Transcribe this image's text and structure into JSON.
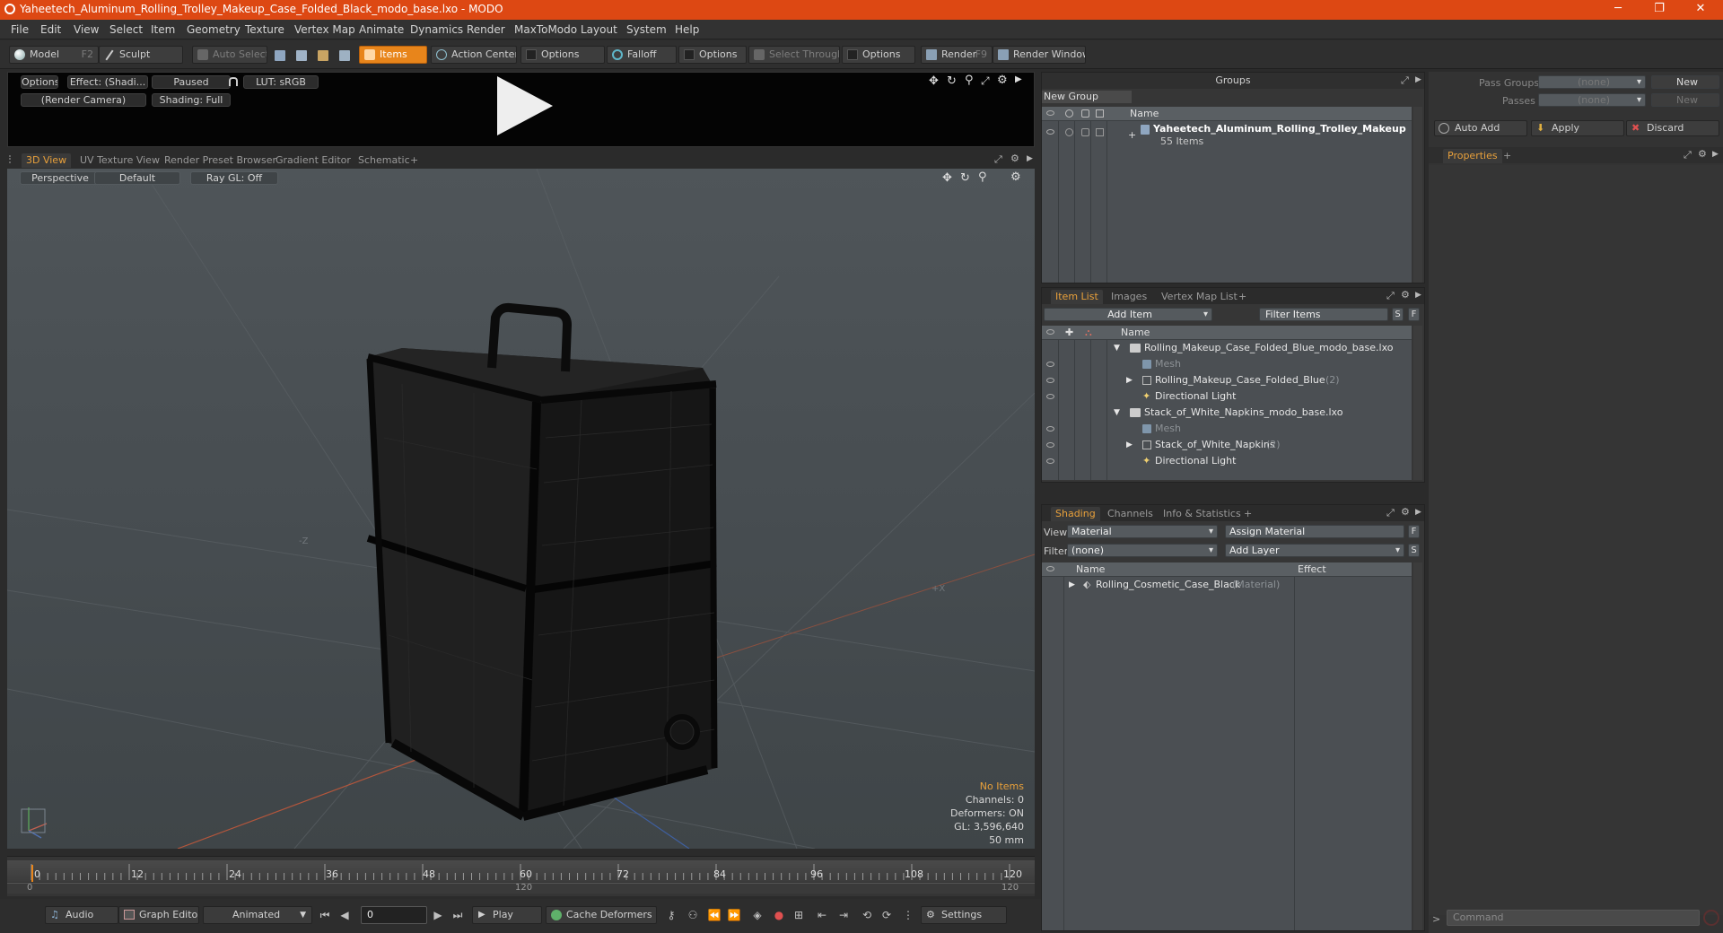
{
  "window": {
    "title": "Yaheetech_Aluminum_Rolling_Trolley_Makeup_Case_Folded_Black_modo_base.lxo - MODO",
    "minimize": "─",
    "restore": "❐",
    "close": "✕"
  },
  "menu": [
    "File",
    "Edit",
    "View",
    "Select",
    "Item",
    "Geometry",
    "Texture",
    "Vertex Map",
    "Animate",
    "Dynamics",
    "Render",
    "MaxToModo",
    "Layout",
    "System",
    "Help"
  ],
  "toolbar": {
    "model": "Model",
    "model_key": "F2",
    "sculpt": "Sculpt",
    "auto_select": "Auto Select",
    "items": "Items",
    "action_center": "Action Center",
    "options1": "Options",
    "falloff": "Falloff",
    "options2": "Options",
    "select_through": "Select Through",
    "options3": "Options",
    "render": "Render",
    "render_key": "F9",
    "render_window": "Render Window"
  },
  "preview": {
    "options": "Options",
    "effect": "Effect: (Shadi...",
    "paused": "Paused",
    "lut": "LUT: sRGB",
    "camera": "(Render Camera)",
    "shading": "Shading: Full"
  },
  "view_tabs": [
    "3D View",
    "UV Texture View",
    "Render Preset Browser",
    "Gradient Editor",
    "Schematic",
    "+"
  ],
  "viewport": {
    "perspective": "Perspective",
    "default": "Default",
    "raygl": "Ray GL: Off",
    "axis_neg_z": "-Z",
    "axis_pos_x": "+X",
    "stats": {
      "no_items": "No Items",
      "channels": "Channels: 0",
      "deformers": "Deformers: ON",
      "gl": "GL: 3,596,640",
      "mm": "50 mm"
    }
  },
  "timeline": {
    "ticks": [
      "0",
      "12",
      "24",
      "36",
      "48",
      "60",
      "72",
      "84",
      "96",
      "108",
      "120"
    ],
    "lower_ticks": [
      "0",
      "120",
      "120"
    ]
  },
  "bottom": {
    "audio": "Audio",
    "graph_editor": "Graph Editor",
    "animated": "Animated",
    "frame": "0",
    "play": "Play",
    "cache_deformers": "Cache Deformers",
    "settings": "Settings"
  },
  "groups": {
    "title": "Groups",
    "new_group": "New Group",
    "col_name": "Name",
    "item_name": "Yaheetech_Aluminum_Rolling_Trolley_Makeup ...",
    "item_count": "55 Items"
  },
  "item_list": {
    "tabs": [
      "Item List",
      "Images",
      "Vertex Map List",
      "+"
    ],
    "add_item": "Add Item",
    "filter": "Filter Items",
    "s": "S",
    "f": "F",
    "col_name": "Name",
    "rows": [
      {
        "label": "Rolling_Makeup_Case_Folded_Blue_modo_base.lxo",
        "extra": "",
        "dim": false
      },
      {
        "label": "Mesh",
        "extra": "",
        "dim": true
      },
      {
        "label": "Rolling_Makeup_Case_Folded_Blue",
        "extra": "(2)",
        "dim": false
      },
      {
        "label": "Directional Light",
        "extra": "",
        "dim": false
      },
      {
        "label": "Stack_of_White_Napkins_modo_base.lxo",
        "extra": "",
        "dim": false
      },
      {
        "label": "Mesh",
        "extra": "",
        "dim": true
      },
      {
        "label": "Stack_of_White_Napkins",
        "extra": "(2)",
        "dim": false
      },
      {
        "label": "Directional Light",
        "extra": "",
        "dim": false
      }
    ]
  },
  "shading": {
    "tabs": [
      "Shading",
      "Channels",
      "Info & Statistics",
      "+"
    ],
    "view_label": "View",
    "view_value": "Material",
    "assign_material": "Assign Material",
    "filter_label": "Filter",
    "filter_value": "(none)",
    "add_layer": "Add Layer",
    "f": "F",
    "s": "S",
    "col_name": "Name",
    "col_effect": "Effect",
    "row_name": "Rolling_Cosmetic_Case_Black",
    "row_type": "(Material)"
  },
  "right": {
    "pass_groups": "Pass Groups",
    "passes": "Passes",
    "none1": "(none)",
    "none2": "(none)",
    "new1": "New",
    "new2": "New",
    "auto_add": "Auto Add",
    "apply": "Apply",
    "discard": "Discard",
    "properties": "Properties",
    "plus": "+",
    "command": "Command"
  },
  "colors": {
    "title_bar": "#dd4813",
    "accent": "#e8851b",
    "tab_active": "#e8a03b"
  }
}
